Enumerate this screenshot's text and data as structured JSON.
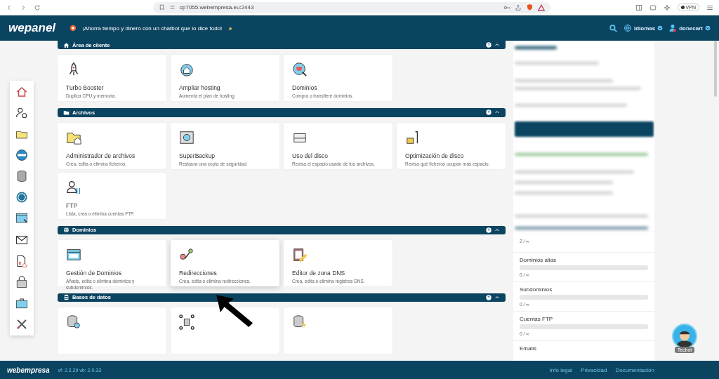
{
  "browser": {
    "url": "cp7055.webempresa.eu:2443",
    "vpn": "VPN"
  },
  "header": {
    "logo": "wepanel",
    "promo": "¡Ahorra tiempo y dinero con un chatbot que lo dice todo!",
    "language": "Idiomas",
    "user": "donecart"
  },
  "sections": [
    {
      "title": "Área de cliente",
      "cards": [
        {
          "title": "Turbo Booster",
          "desc": "Duplica CPU y memoria.",
          "hovered": false
        },
        {
          "title": "Ampliar hosting",
          "desc": "Aumenta el plan de hosting",
          "hovered": false
        },
        {
          "title": "Dominios",
          "desc": "Compra o transfiere dominios.",
          "hovered": false
        }
      ]
    },
    {
      "title": "Archivos",
      "cards": [
        {
          "title": "Administrador de archivos",
          "desc": "Crea, edita o elimina ficheros.",
          "hovered": false
        },
        {
          "title": "SuperBackup",
          "desc": "Restaura una copia de seguridad.",
          "hovered": false
        },
        {
          "title": "Uso del disco",
          "desc": "Revisa el espacio usado de tus archivos.",
          "hovered": false
        },
        {
          "title": "Optimización de disco",
          "desc": "Revisa qué ficheros ocupan más espacio.",
          "hovered": false
        },
        {
          "title": "FTP",
          "desc": "Lista, crea o elimina cuentas FTP.",
          "hovered": false
        }
      ]
    },
    {
      "title": "Dominios",
      "cards": [
        {
          "title": "Gestión de Dominios",
          "desc": "Añade, edita o elimina dominios y subdominios.",
          "hovered": false
        },
        {
          "title": "Redirecciones",
          "desc": "Crea, edita o elimina redirecciones.",
          "hovered": true
        },
        {
          "title": "Editor de zona DNS",
          "desc": "Crea, edita o elimina registros DNS.",
          "hovered": false
        }
      ]
    },
    {
      "title": "Bases de datos",
      "cards": [
        {
          "hovered": false
        },
        {
          "hovered": false
        },
        {
          "hovered": false
        }
      ]
    }
  ],
  "stats": [
    {
      "value": "2 / ∞"
    },
    {
      "label": "Dominios alias",
      "level": 0,
      "value": "0 / ∞"
    },
    {
      "label": "Subdominios",
      "level": 0,
      "value": "0 / ∞"
    },
    {
      "label": "Cuentas FTP",
      "level": 0,
      "value": "0 / ∞"
    },
    {
      "label": "Emails"
    }
  ],
  "assistant": {
    "name": "Tecbot"
  },
  "footer": {
    "brand": "webempresa",
    "version": "vf: 2.2.29 vb: 2.0.33",
    "links": [
      "Info legal",
      "Privacidad",
      "Documentación"
    ]
  }
}
